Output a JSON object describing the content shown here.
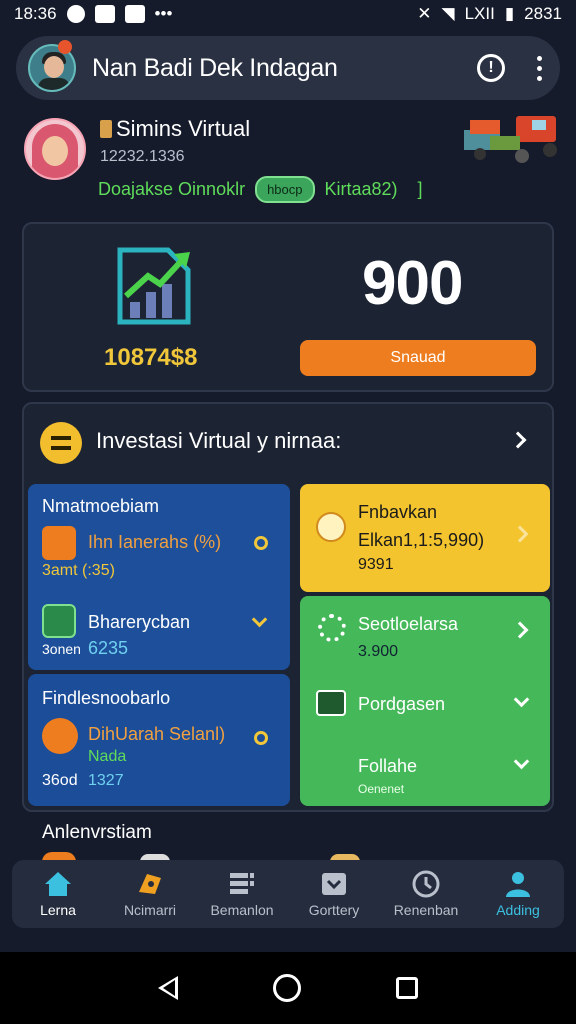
{
  "status_bar": {
    "time": "18:36",
    "right_text": "2831",
    "lte": "LXII"
  },
  "app_bar": {
    "title": "Nan Badi Dek Indagan"
  },
  "profile": {
    "name": "Simins Virtual",
    "id": "12232.1336",
    "tag_green": "Doajakse Oinnoklr",
    "tag_pill": "hbocp",
    "tag_right": "Kirtaa82)",
    "tag_bracket": "]"
  },
  "stats": {
    "amount": "10874$8",
    "big_value": "900",
    "button_label": "Snauad"
  },
  "invest": {
    "title": "Investasi Virtual y nirnaa:",
    "blue1": {
      "heading": "Nmatmoebiam",
      "row1_label": "Ihn Ianerahs (%)",
      "row1_value": "3amt (:35)",
      "row2_label": "Bharerycban",
      "row2_sub": "3onen",
      "row2_value": "6235"
    },
    "blue2": {
      "heading": "Findlesnoobarlo",
      "row_label": "DihUarah Selanl)",
      "row_sub": "Nada",
      "row_value_a": "36od",
      "row_value_b": "1327"
    },
    "yellow": {
      "label": "Fnbavkan",
      "line2": "Elkan1,1:5,990)",
      "line3": "9391"
    },
    "green": {
      "row1_label": "Seotloelarsa",
      "row1_value": "3.900",
      "row2_label": "Pordgasen",
      "row3_label": "Follahe",
      "row3_sub": "Oenenet"
    }
  },
  "section3": {
    "title": "Anlenvrstiam"
  },
  "bottom_nav": [
    {
      "label": "Lerna",
      "icon": "home-icon",
      "active": true
    },
    {
      "label": "Ncimarri",
      "icon": "tag-icon",
      "active": false
    },
    {
      "label": "Bemanlon",
      "icon": "list-icon",
      "active": false
    },
    {
      "label": "Gorttery",
      "icon": "inbox-icon",
      "active": false
    },
    {
      "label": "Renenban",
      "icon": "clock-icon",
      "active": false
    },
    {
      "label": "Adding",
      "icon": "profile-icon",
      "active": false
    }
  ],
  "colors": {
    "background": "#151b2b",
    "accent_orange": "#ee7d1f",
    "accent_yellow": "#f3c42d",
    "accent_green": "#45b95a",
    "accent_blue": "#1d4f9a",
    "nav_active": "#3cc0e0"
  }
}
